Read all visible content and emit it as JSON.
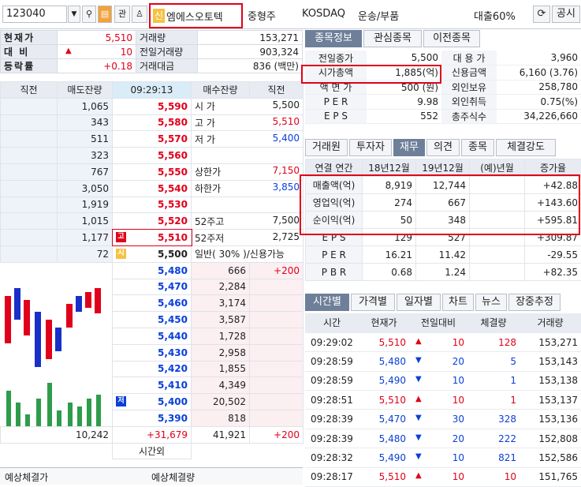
{
  "topbar": {
    "code": "123040",
    "gwan_label": "관",
    "stock_badge": "신",
    "stock_name": "엠에스오토텍",
    "size_class": "중형주",
    "market": "KOSDAQ",
    "sector": "운송/부품",
    "loan_rate": "대출60%",
    "gongsi_label": "공시"
  },
  "summary": {
    "left": [
      {
        "label": "현재가",
        "value": "5,510",
        "sign": ""
      },
      {
        "label": "대  비",
        "value": "10",
        "sign": "▲"
      },
      {
        "label": "등락률",
        "value": "+0.18",
        "sign": ""
      }
    ],
    "right": [
      {
        "label": "거래량",
        "value": "153,271"
      },
      {
        "label": "전일거래량",
        "value": "903,324"
      },
      {
        "label": "거래대금",
        "value": "836 (백만)"
      }
    ]
  },
  "orderbook": {
    "headers": {
      "prev": "직전",
      "ask_qty": "매도잔량",
      "time": "09:29:13",
      "bid_qty": "매수잔량",
      "prev2": "직전"
    },
    "asks": [
      {
        "qty": "1,065",
        "price": "5,590",
        "info_label": "시 가",
        "info_value": "5,500",
        "info_color": "black"
      },
      {
        "qty": "343",
        "price": "5,580",
        "info_label": "고 가",
        "info_value": "5,510",
        "info_color": "red"
      },
      {
        "qty": "511",
        "price": "5,570",
        "info_label": "저 가",
        "info_value": "5,400",
        "info_color": "blue"
      },
      {
        "qty": "323",
        "price": "5,560",
        "info_label": "",
        "info_value": "",
        "info_color": "black"
      },
      {
        "qty": "767",
        "price": "5,550",
        "info_label": "상한가",
        "info_value": "7,150",
        "info_color": "red"
      },
      {
        "qty": "3,050",
        "price": "5,540",
        "info_label": "하한가",
        "info_value": "3,850",
        "info_color": "blue"
      },
      {
        "qty": "1,919",
        "price": "5,530",
        "info_label": "",
        "info_value": "",
        "info_color": "black"
      },
      {
        "qty": "1,015",
        "price": "5,520",
        "info_label": "52주고",
        "info_value": "7,500",
        "info_color": "black"
      },
      {
        "qty": "1,177",
        "price": "5,510",
        "info_label": "52주저",
        "info_value": "2,725",
        "info_color": "black",
        "mark": "고"
      },
      {
        "qty": "72",
        "price": "5,500",
        "info_label": "일반(  30% )/신용가능",
        "info_value": "",
        "info_color": "black",
        "mark": "시"
      }
    ],
    "bids": [
      {
        "price": "5,480",
        "qty": "666",
        "extra": "+200"
      },
      {
        "price": "5,470",
        "qty": "2,284",
        "extra": ""
      },
      {
        "price": "5,460",
        "qty": "3,174",
        "extra": ""
      },
      {
        "price": "5,450",
        "qty": "3,587",
        "extra": ""
      },
      {
        "price": "5,440",
        "qty": "1,728",
        "extra": ""
      },
      {
        "price": "5,430",
        "qty": "2,958",
        "extra": ""
      },
      {
        "price": "5,420",
        "qty": "1,855",
        "extra": ""
      },
      {
        "price": "5,410",
        "qty": "4,349",
        "extra": ""
      },
      {
        "price": "5,400",
        "qty": "20,502",
        "extra": "",
        "mark": "저"
      },
      {
        "price": "5,390",
        "qty": "818",
        "extra": ""
      }
    ],
    "totals": {
      "ask_total": "10,242",
      "diff": "+31,679",
      "bid_total": "41,921",
      "bid_extra": "+200"
    },
    "after_hours": "시간외",
    "footer_left": "예상체결가",
    "footer_right": "예상체결량"
  },
  "info_tabs": [
    "종목정보",
    "관심종목",
    "이전종목"
  ],
  "info": [
    {
      "l1": "전일종가",
      "v1": "5,500",
      "l2": "대 용 가",
      "v2": "3,960"
    },
    {
      "l1": "시가총액",
      "v1": "1,885(억)",
      "l2": "신용금액",
      "v2": "6,160  (3.76)"
    },
    {
      "l1": "액 면 가",
      "v1": "500 (원)",
      "l2": "외인보유",
      "v2": "258,780"
    },
    {
      "l1": "P E R",
      "v1": "9.98",
      "l2": "외인취득",
      "v2": "0.75(%)"
    },
    {
      "l1": "E P S",
      "v1": "552",
      "l2": "총주식수",
      "v2": "34,226,660"
    }
  ],
  "fin_tabs": [
    "거래원",
    "투자자",
    "재무",
    "의견",
    "종목",
    "체결강도"
  ],
  "fin": {
    "headers": [
      "연결",
      "연간",
      "18년12월",
      "19년12월",
      "(예)년월",
      "증가율"
    ],
    "rows": [
      {
        "label": "매출액(억)",
        "y18": "8,919",
        "y19": "12,744",
        "est": "",
        "growth": "+42.88"
      },
      {
        "label": "영업익(억)",
        "y18": "274",
        "y19": "667",
        "est": "",
        "growth": "+143.60"
      },
      {
        "label": "순이익(억)",
        "y18": "50",
        "y19": "348",
        "est": "",
        "growth": "+595.81"
      },
      {
        "label": "E P S",
        "y18": "129",
        "y19": "527",
        "est": "",
        "growth": "+309.87"
      },
      {
        "label": "P E R",
        "y18": "16.21",
        "y19": "11.42",
        "est": "",
        "growth": "-29.55"
      },
      {
        "label": "P B R",
        "y18": "0.68",
        "y19": "1.24",
        "est": "",
        "growth": "+82.35"
      }
    ]
  },
  "trade_tabs": [
    "시간별",
    "가격별",
    "일자별",
    "차트",
    "뉴스",
    "장중추정"
  ],
  "trades": {
    "headers": [
      "시간",
      "현재가",
      "전일대비",
      "체결량",
      "거래량"
    ],
    "rows": [
      {
        "time": "09:29:02",
        "price": "5,510",
        "dir": "up",
        "diff": "10",
        "vol": "128",
        "total": "153,271"
      },
      {
        "time": "09:28:59",
        "price": "5,480",
        "dir": "down",
        "diff": "20",
        "vol": "5",
        "total": "153,143"
      },
      {
        "time": "09:28:59",
        "price": "5,490",
        "dir": "down",
        "diff": "10",
        "vol": "1",
        "total": "153,138"
      },
      {
        "time": "09:28:51",
        "price": "5,510",
        "dir": "up",
        "diff": "10",
        "vol": "1",
        "total": "153,137"
      },
      {
        "time": "09:28:39",
        "price": "5,470",
        "dir": "down",
        "diff": "30",
        "vol": "328",
        "total": "153,136"
      },
      {
        "time": "09:28:39",
        "price": "5,480",
        "dir": "down",
        "diff": "20",
        "vol": "222",
        "total": "152,808"
      },
      {
        "time": "09:28:32",
        "price": "5,490",
        "dir": "down",
        "diff": "10",
        "vol": "821",
        "total": "152,586"
      },
      {
        "time": "09:28:17",
        "price": "5,510",
        "dir": "up",
        "diff": "10",
        "vol": "10",
        "total": "151,765"
      }
    ]
  },
  "colors": {
    "up": "#e0001b",
    "down": "#0a3fd8",
    "header_bg": "#e8ecf2",
    "active_tab": "#6e7f99",
    "highlight": "#e0001b"
  }
}
